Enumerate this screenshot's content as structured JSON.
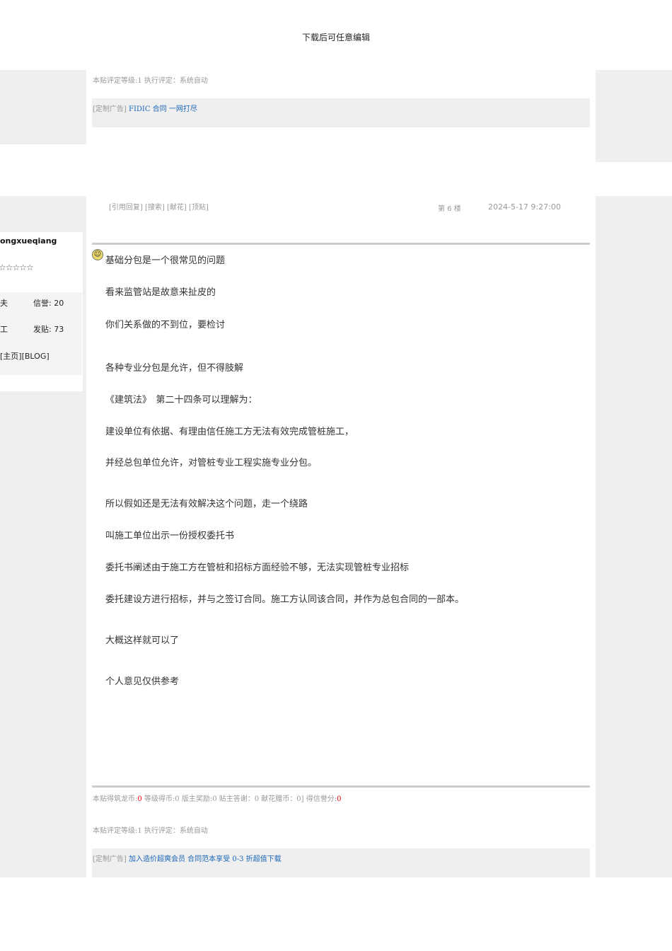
{
  "header": {
    "title": "下载后可任意编辑"
  },
  "post5": {
    "rating": "本贴评定等级:1 执行评定：系统自动",
    "ad_prefix": "[定制广告]",
    "ad_link": "FIDIC 合同 一网打尽"
  },
  "post6": {
    "actions": [
      "[引用回复]",
      "[搜索]",
      "[献花]",
      "[顶贴]"
    ],
    "floor": "第 6 楼",
    "timestamp": "2024-5-17 9:27:00",
    "user": {
      "name": "ongxueqiang",
      "stars": "☆☆☆☆☆",
      "left1": "夫",
      "credit": "信誉: 20",
      "left2": "工",
      "posts": "发贴: 73",
      "links": "[主页][BLOG]"
    },
    "lines": [
      "基础分包是一个很常见的问题",
      "看来监管站是故意来扯皮的",
      "你们关系做的不到位，要检讨",
      "各种专业分包是允许，但不得肢解",
      "《建筑法》　第二十四条可以理解为：",
      "建设单位有依据、有理由信任施工方无法有效完成管桩施工，",
      "并经总包单位允许，对管桩专业工程实施专业分包。",
      "所以假如还是无法有效解决这个问题，走一个绕路",
      "叫施工单位出示一份授权委托书",
      "委托书阐述由于施工方在管桩和招标方面经验不够，无法实现管桩专业招标",
      "委托建设方进行招标，并与之签订合同。施工方认同该合同，并作为总包合同的一部本。",
      "大概这样就可以了",
      "个人意见仅供参考"
    ],
    "coins": {
      "p1": "本贴得筑龙币:",
      "v1": "0",
      "p2": " 等级得币:0 版主奖励:0 贴主答谢：0 献花赠币：0] 得信誉分:",
      "v2": "0"
    },
    "rating": "本贴评定等级:1 执行评定：系统自动",
    "ad_prefix": "[定制广告]",
    "ad_link": "加入造价超爽会员 合同范本享受 0-3 折超值下载"
  }
}
